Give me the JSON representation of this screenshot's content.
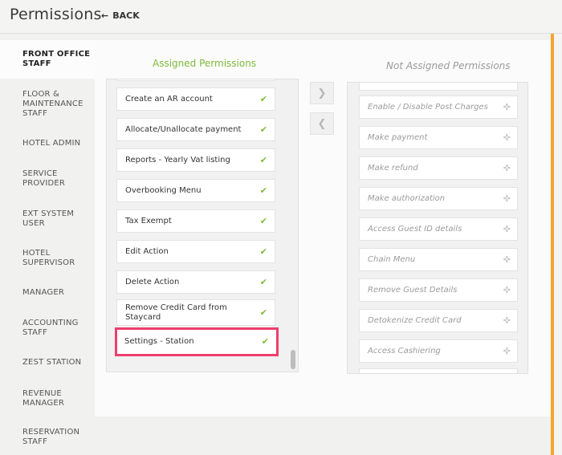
{
  "header": {
    "title": "Permissions",
    "back_label": "BACK"
  },
  "sidebar": {
    "items": [
      {
        "label": "FRONT OFFICE STAFF",
        "active": true
      },
      {
        "label": "FLOOR & MAINTENANCE STAFF"
      },
      {
        "label": "HOTEL ADMIN"
      },
      {
        "label": "SERVICE PROVIDER"
      },
      {
        "label": "EXT SYSTEM USER"
      },
      {
        "label": "HOTEL SUPERVISOR"
      },
      {
        "label": "MANAGER"
      },
      {
        "label": "ACCOUNTING STAFF"
      },
      {
        "label": "ZEST STATION"
      },
      {
        "label": "REVENUE MANAGER"
      },
      {
        "label": "RESERVATION STAFF"
      }
    ]
  },
  "assigned": {
    "title": "Assigned Permissions",
    "items": [
      "Create an AR account",
      "Allocate/Unallocate payment",
      "Reports - Yearly Vat listing",
      "Overbooking Menu",
      "Tax Exempt",
      "Edit Action",
      "Delete Action",
      "Remove Credit Card from Staycard",
      "Settings - Station"
    ]
  },
  "not_assigned": {
    "title": "Not Assigned Permissions",
    "items": [
      "Enable / Disable Post Charges",
      "Make payment",
      "Make refund",
      "Make authorization",
      "Access Guest ID details",
      "Chain Menu",
      "Remove Guest Details",
      "Detokenize Credit Card",
      "Access Cashiering"
    ]
  },
  "icons": {
    "back": "arrow-left-icon",
    "check": "check-icon",
    "drag": "drag-handle-icon",
    "move_right": "chevron-right-icon",
    "move_left": "chevron-left-icon"
  },
  "colors": {
    "accent_green": "#7dbb3a",
    "highlight_pink": "#ef3e6e",
    "orange_bar": "#f3a530"
  }
}
